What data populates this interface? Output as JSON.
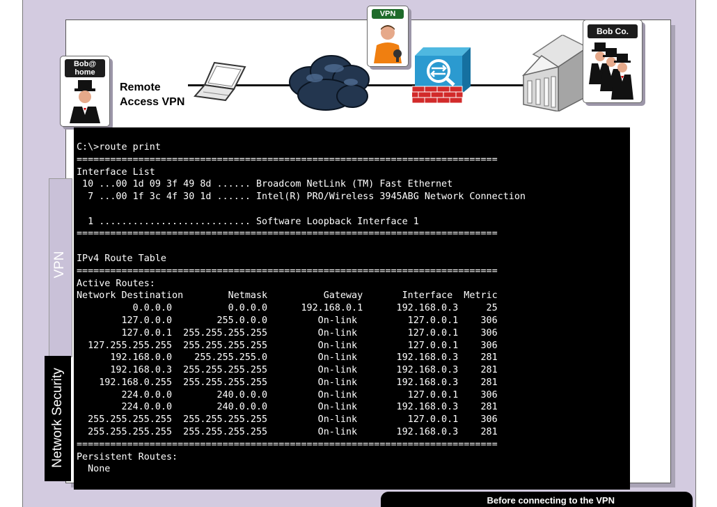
{
  "labels": {
    "bob_home": "Bob@\nhome",
    "vpn_badge": "VPN",
    "bob_co": "Bob Co.",
    "remote_access": "Remote\nAccess VPN"
  },
  "side_tabs": {
    "vpn": "VPN",
    "network_security": "Network Security"
  },
  "caption": "Before connecting to the VPN",
  "colors": {
    "slide_bg": "#d3cbe0",
    "terminal_bg": "#000000",
    "vpn_badge": "#1e6b2a"
  },
  "terminal": {
    "lines": [
      "C:\\>route print",
      "===========================================================================",
      "Interface List",
      " 10 ...00 1d 09 3f 49 8d ...... Broadcom NetLink (TM) Fast Ethernet",
      "  7 ...00 1f 3c 4f 30 1d ...... Intel(R) PRO/Wireless 3945ABG Network Connection",
      "",
      "  1 ........................... Software Loopback Interface 1",
      "===========================================================================",
      "",
      "IPv4 Route Table",
      "===========================================================================",
      "Active Routes:",
      "Network Destination        Netmask          Gateway       Interface  Metric",
      "          0.0.0.0          0.0.0.0      192.168.0.1      192.168.0.3     25",
      "        127.0.0.0        255.0.0.0         On-link         127.0.0.1    306",
      "        127.0.0.1  255.255.255.255         On-link         127.0.0.1    306",
      "  127.255.255.255  255.255.255.255         On-link         127.0.0.1    306",
      "      192.168.0.0    255.255.255.0         On-link       192.168.0.3    281",
      "      192.168.0.3  255.255.255.255         On-link       192.168.0.3    281",
      "    192.168.0.255  255.255.255.255         On-link       192.168.0.3    281",
      "        224.0.0.0        240.0.0.0         On-link         127.0.0.1    306",
      "        224.0.0.0        240.0.0.0         On-link       192.168.0.3    281",
      "  255.255.255.255  255.255.255.255         On-link         127.0.0.1    306",
      "  255.255.255.255  255.255.255.255         On-link       192.168.0.3    281",
      "===========================================================================",
      "Persistent Routes:",
      "  None"
    ]
  }
}
